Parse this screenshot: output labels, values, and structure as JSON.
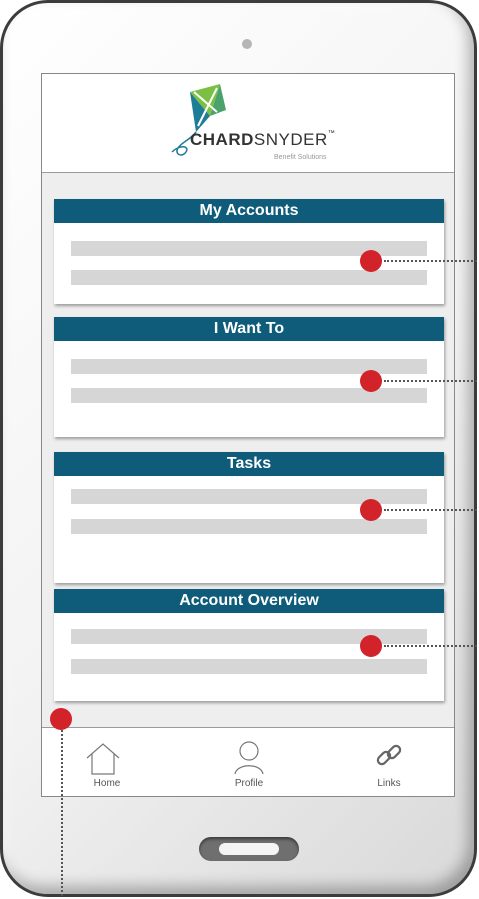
{
  "brand": {
    "name_bold": "CHARD",
    "name_regular": "SNYDER",
    "trademark": "™",
    "tagline": "Benefit Solutions",
    "colors": {
      "kite_green": "#7ac143",
      "kite_teal": "#1e7d96",
      "kite_blue": "#0f5b7a"
    }
  },
  "cards": [
    {
      "title": "My Accounts"
    },
    {
      "title": "I Want To"
    },
    {
      "title": "Tasks"
    },
    {
      "title": "Account Overview"
    }
  ],
  "tabbar": {
    "home_label": "Home",
    "profile_label": "Profile",
    "links_label": "Links",
    "icons": {
      "home": "house-icon",
      "profile": "person-icon",
      "links": "chain-link-icon"
    }
  },
  "theme": {
    "card_header": "#0f5b7a",
    "marker": "#d2232a",
    "placeholder_bar": "#d6d6d6",
    "screen_background": "#eeeeee"
  }
}
